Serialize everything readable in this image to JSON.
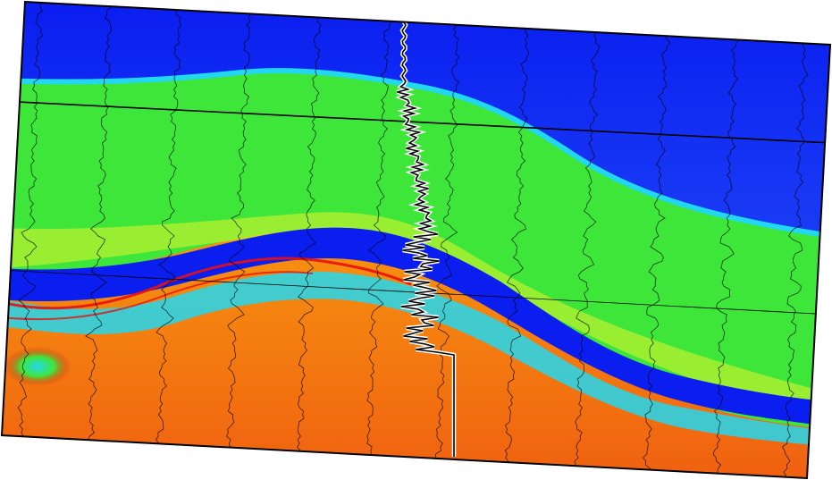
{
  "image": {
    "description_free": true,
    "palette": {
      "deep_blue": "#0a1ef0",
      "mid_blue": "#1a3cf5",
      "cyan": "#22d8f0",
      "green": "#3fe63a",
      "yellow_green": "#b8f030",
      "yellow": "#f5f020",
      "orange": "#f8a010",
      "red_orange": "#f06010",
      "red": "#e81010",
      "trace_color": "#000000",
      "well_log_outline": "#ffffff",
      "frame_color": "#000000",
      "background": "#ffffff"
    }
  }
}
